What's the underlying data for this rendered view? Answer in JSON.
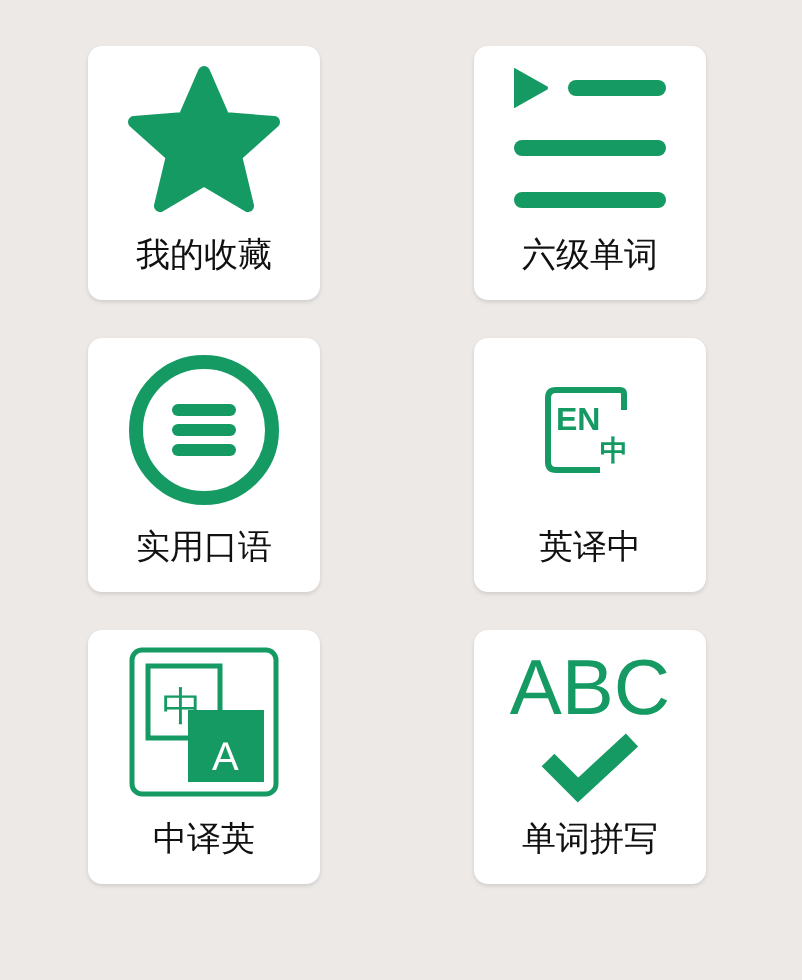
{
  "rows": [
    {
      "tiles": [
        {
          "label": "我的收藏",
          "kind": "star"
        },
        {
          "label": "六级单词",
          "kind": "list"
        }
      ]
    },
    {
      "tiles": [
        {
          "label": "实用口语",
          "kind": "menu-circle"
        },
        {
          "label": "英译中",
          "kind": "en-zh",
          "glyphs": [
            "EN",
            "中"
          ]
        }
      ]
    },
    {
      "tiles": [
        {
          "label": "中译英",
          "kind": "zh-en",
          "glyphs": [
            "中",
            "A"
          ]
        },
        {
          "label": "单词拼写",
          "kind": "spell",
          "glyphs": [
            "ABC"
          ]
        }
      ]
    }
  ]
}
